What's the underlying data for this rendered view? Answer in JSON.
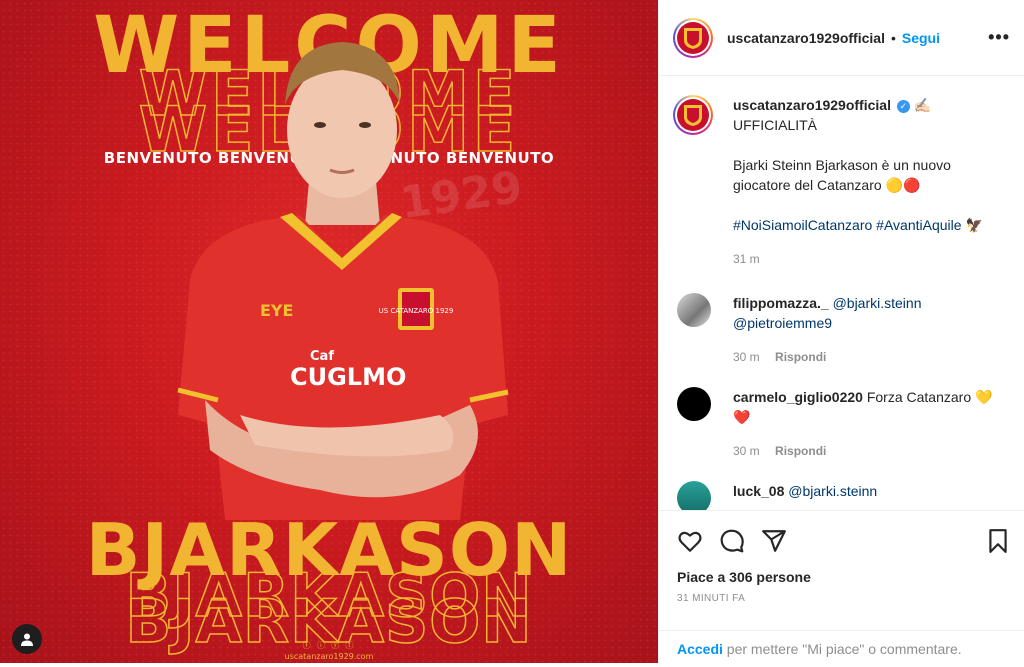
{
  "post_image": {
    "headline": "WELCOME",
    "benvenuto": "BENVENUTO BENVENUTO BENVENUTO BENVENUTO",
    "surname": "BJARKASON",
    "social_icons": "ⓕ ⓘ ⓨ ⓣ",
    "website": "uscatanzaro1929.com",
    "ghost_text": "1929",
    "crest_text": "US CATANZARO 1929",
    "sponsor_left": "EYE",
    "sponsor_chest": "CUGLMO",
    "sponsor_small": "Caf"
  },
  "header": {
    "username": "uscatanzaro1929official",
    "separator": "•",
    "follow_label": "Segui",
    "more_label": "•••"
  },
  "caption": {
    "username": "uscatanzaro1929official",
    "verified_mark": "✓",
    "emoji_after_name": "✍🏻",
    "line1": "UFFICIALITÀ",
    "line2": "Bjarki Steinn Bjarkason è un nuovo giocatore del Catanzaro 🟡🔴",
    "hashtags": "#NoiSiamoilCatanzaro #AvantiAquile",
    "hashtag_emoji": "🦅",
    "time": "31 m"
  },
  "comments": [
    {
      "username": "filippomazza._",
      "text": "@bjarki.steinn @pietroiemme9",
      "time": "30 m",
      "reply_label": "Rispondi"
    },
    {
      "username": "carmelo_giglio0220",
      "text": "Forza Catanzaro 💛❤️",
      "time": "30 m",
      "reply_label": "Rispondi"
    },
    {
      "username": "luck_08",
      "text": "@bjarki.steinn"
    }
  ],
  "actions": {
    "likes": "Piace a 306 persone",
    "timestamp": "31 MINUTI FA"
  },
  "login_bar": {
    "link": "Accedi",
    "text": " per mettere \"Mi piace\" o commentare."
  },
  "colors": {
    "accent_blue": "#0095f6",
    "poster_red": "#c91a1f",
    "poster_yellow": "#f2b531"
  }
}
